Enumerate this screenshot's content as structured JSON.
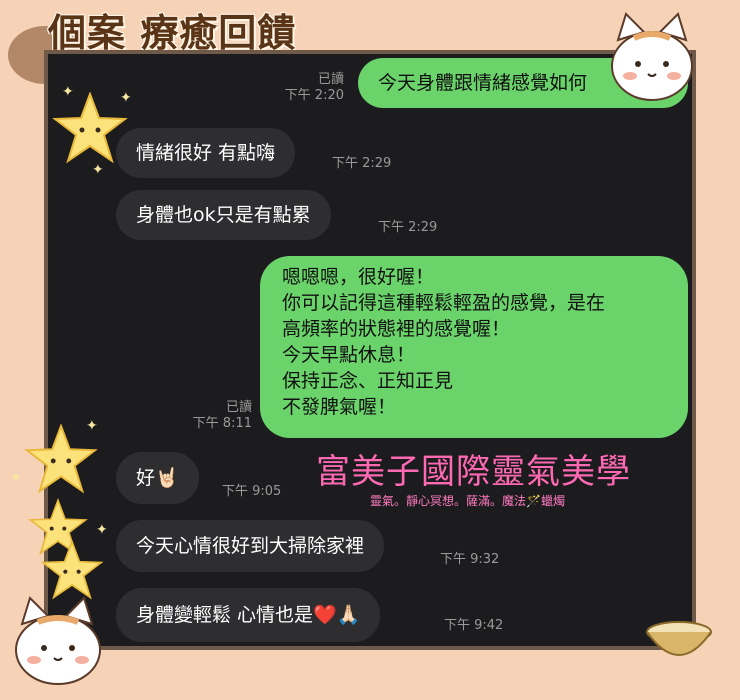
{
  "title": "個案 療癒回饋",
  "messages": [
    {
      "text": "今天身體跟情緒感覺如何",
      "read": "已讀",
      "time": "下午 2:20"
    },
    {
      "text": "情緒很好 有點嗨",
      "time": "下午 2:29"
    },
    {
      "text": "身體也ok只是有點累",
      "time": "下午 2:29"
    },
    {
      "lines": [
        "嗯嗯嗯，很好喔！",
        "你可以記得這種輕鬆輕盈的感覺，是在",
        "高頻率的狀態裡的感覺喔！",
        "今天早點休息！",
        "保持正念、正知正見",
        "不發脾氣喔！"
      ],
      "read": "已讀",
      "time": "下午 8:11"
    },
    {
      "text": "好🤘🏻",
      "time": "下午 9:05"
    },
    {
      "text": "今天心情很好到大掃除家裡",
      "time": "下午 9:32"
    },
    {
      "text": "身體變輕鬆 心情也是❤️🙏🏻",
      "time": "下午 9:42"
    }
  ],
  "brand": {
    "name": "富美子國際靈氣美學",
    "tagline": "靈氣。靜心冥想。薩滿。魔法🪄蠟燭"
  },
  "colors": {
    "background": "#f6d2b6",
    "chat_bg": "#1c1c1e",
    "bubble_out": "#6ad36a",
    "bubble_in": "#2e2e31",
    "brand": "#ff69b4"
  }
}
